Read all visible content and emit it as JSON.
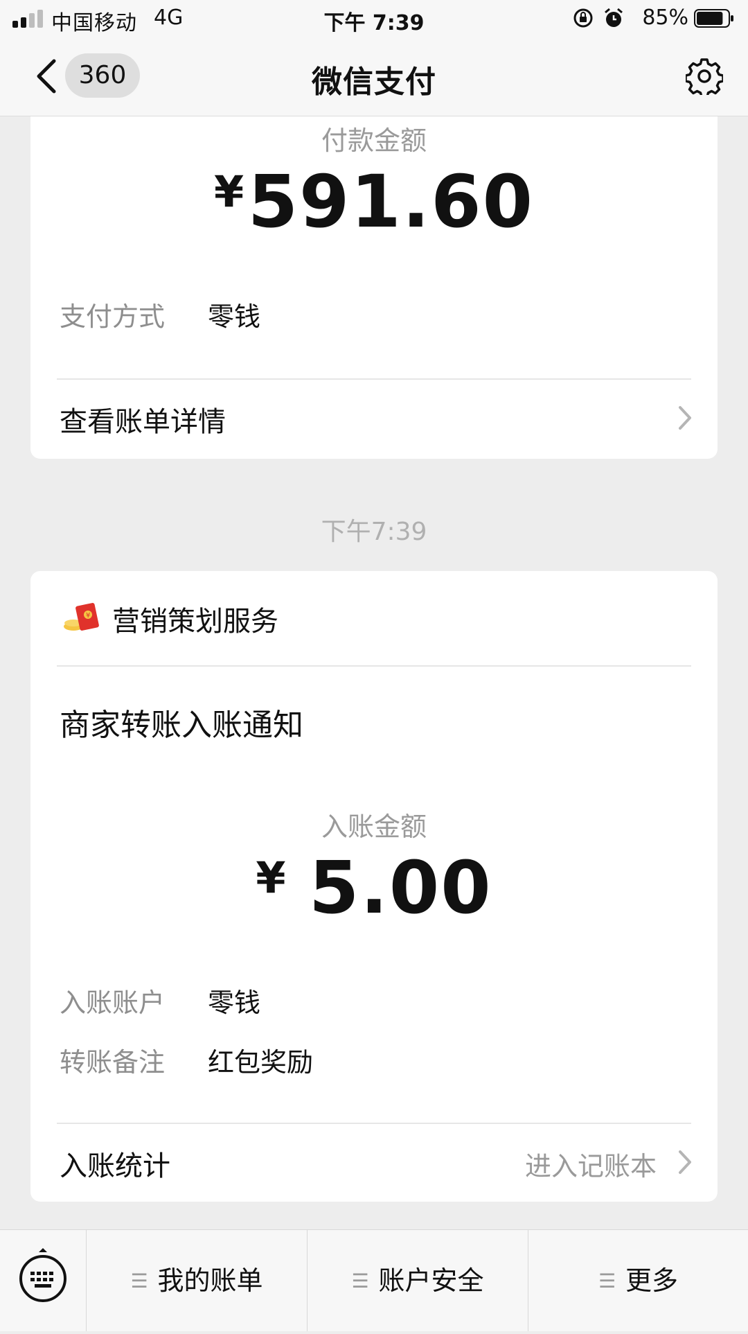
{
  "status_bar": {
    "carrier": "中国移动",
    "network": "4G",
    "time": "下午 7:39",
    "battery": "85%",
    "battery_level": 0.85,
    "icons": [
      "signal-icon",
      "orientation-lock-icon",
      "alarm-icon",
      "battery-icon"
    ]
  },
  "nav": {
    "back_badge": "360",
    "title": "微信支付",
    "icons": [
      "back-chevron-icon",
      "gear-icon"
    ]
  },
  "payment_card": {
    "amount_label": "付款金额",
    "currency": "¥",
    "amount": "591.60",
    "method_key": "支付方式",
    "method_value": "零钱",
    "details_link": "查看账单详情"
  },
  "timestamp": "下午7:39",
  "notice_card": {
    "brand_icon": "red-envelope-icon",
    "brand_name": "营销策划服务",
    "title": "商家转账入账通知",
    "amount_label": "入账金额",
    "currency": "¥",
    "amount": "5.00",
    "account_key": "入账账户",
    "account_value": "零钱",
    "remark_key": "转账备注",
    "remark_value": "红包奖励",
    "stats_label": "入账统计",
    "stats_hint": "进入记账本"
  },
  "bottom_menu": {
    "keyboard_icon": "keyboard-icon",
    "items": [
      {
        "label": "我的账单"
      },
      {
        "label": "账户安全"
      },
      {
        "label": "更多"
      }
    ]
  },
  "colors": {
    "background": "#ededed",
    "card": "#ffffff",
    "secondary_text": "#9a9a9a",
    "envelope_red": "#e0322b",
    "coin_gold": "#f5c542"
  }
}
